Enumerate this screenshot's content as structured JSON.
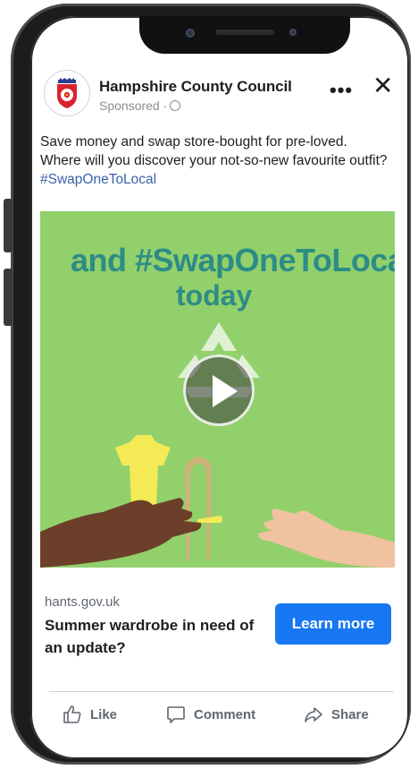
{
  "post": {
    "page_name": "Hampshire County Council",
    "sponsored": "Sponsored ·",
    "text_main": "Save money and swap store-bought for pre-loved. Where will you discover your not-so-new favourite outfit? ",
    "hashtag": "#SwapOneToLocal"
  },
  "media": {
    "headline_line1": "and #SwapOneToLocal",
    "headline_line2": "today"
  },
  "link": {
    "domain": "hants.gov.uk",
    "title": "Summer wardrobe in need of an update?",
    "cta_label": "Learn more"
  },
  "actions": {
    "like": "Like",
    "comment": "Comment",
    "share": "Share"
  },
  "colors": {
    "brand": "#1877f2",
    "media_bg": "#92d06b",
    "headline": "#2d8c86"
  }
}
